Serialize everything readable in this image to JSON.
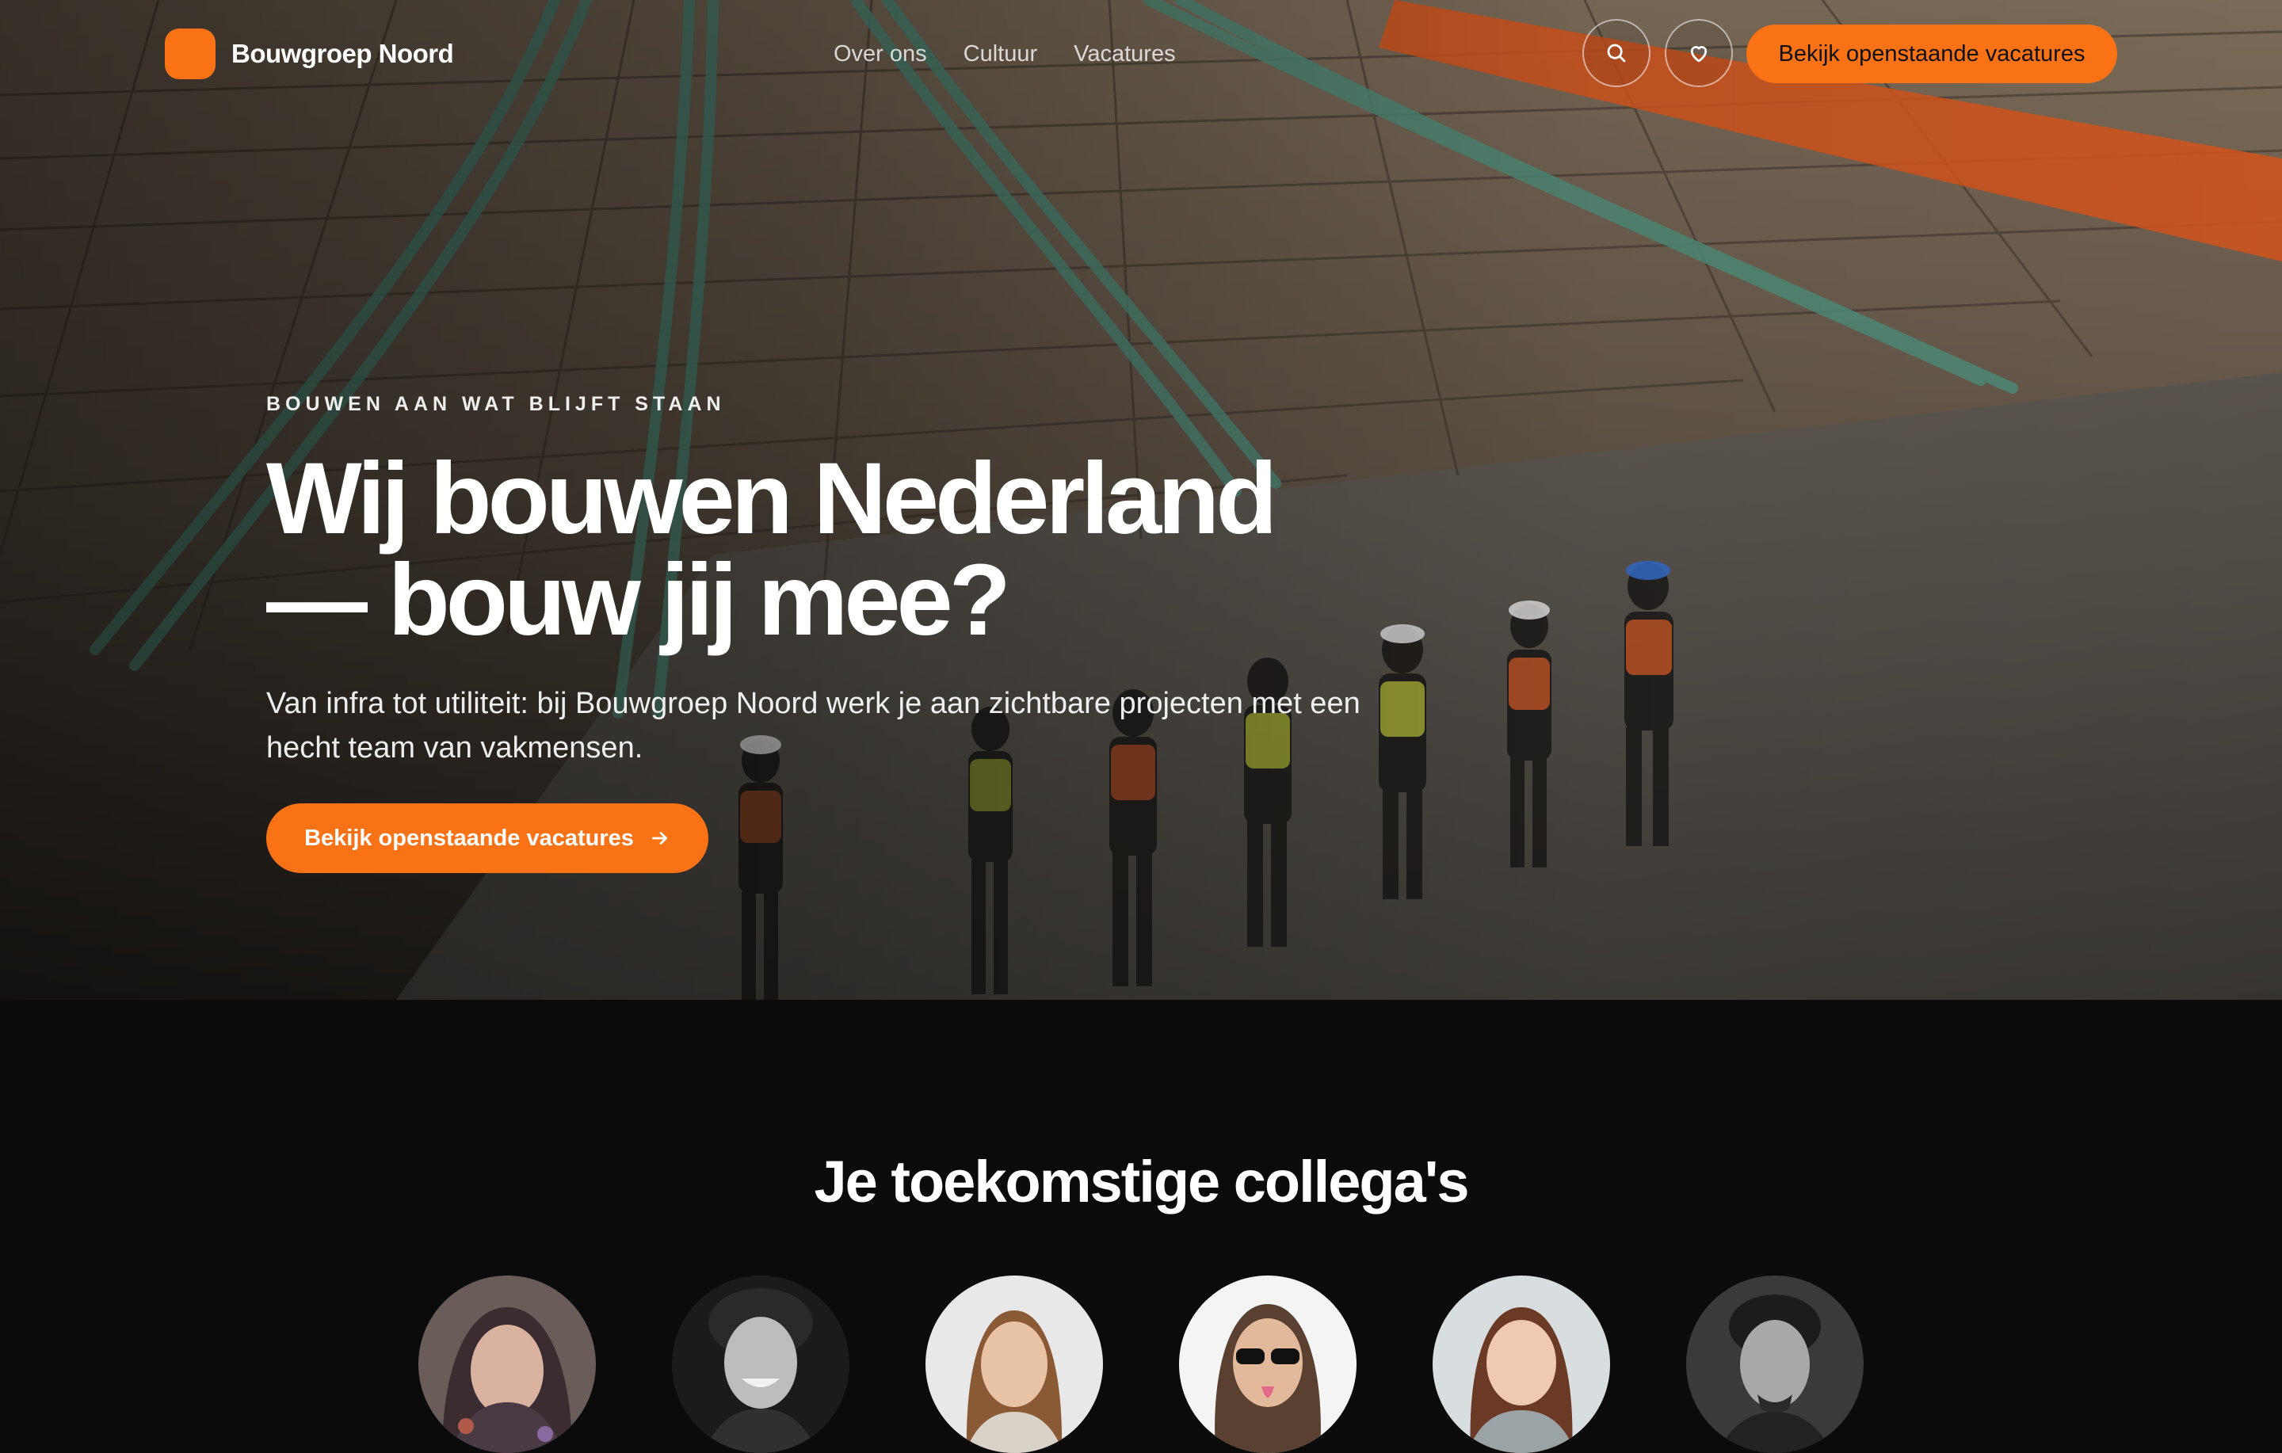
{
  "brand": {
    "name": "Bouwgroep Noord",
    "accent": "#f97316"
  },
  "nav": {
    "links": [
      "Over ons",
      "Cultuur",
      "Vacatures"
    ],
    "search_icon": "search-icon",
    "favorites_icon": "heart-icon",
    "cta_label": "Bekijk openstaande vacatures"
  },
  "hero": {
    "eyebrow": "BOUWEN AAN WAT BLIJFT STAAN",
    "headline_line1": "Wij bouwen Nederland",
    "headline_line2": "— bouw jij mee?",
    "lead": "Van infra tot utiliteit: bij Bouwgroep Noord werk je aan zichtbare projecten met een hecht team van vakmensen.",
    "cta_label": "Bekijk openstaande vacatures",
    "cta_icon": "arrow-right-icon"
  },
  "colleagues": {
    "title": "Je toekomstige collega's",
    "avatar_count": 6
  }
}
